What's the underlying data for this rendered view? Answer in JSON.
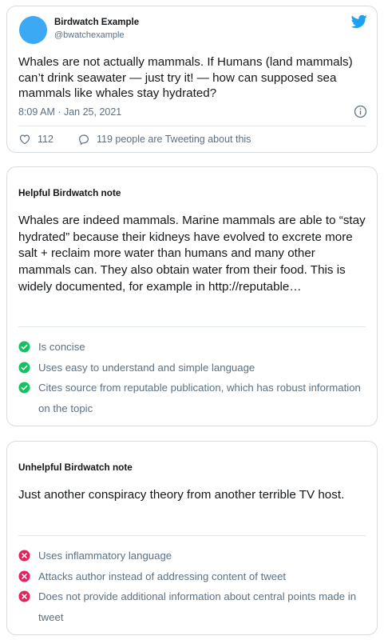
{
  "tweet": {
    "display_name": "Birdwatch Example",
    "handle": "@bwatchexample",
    "text": "Whales are not actually mammals. If Humans (land mammals) can’t drink seawater — just try it! — how can supposed sea mammals like whales stay hydrated?",
    "timestamp": "8:09 AM · Jan 25, 2021",
    "likes": "112",
    "tweeting_about": "119 people are Tweeting about this",
    "avatar_color": "#3ba9f3",
    "brand_color": "#1da1f2",
    "icons": [
      "twitter-bird-icon",
      "info-icon",
      "heart-icon",
      "comment-bubble-icon"
    ]
  },
  "helpful_note": {
    "heading": "Helpful Birdwatch note",
    "text": "Whales are indeed mammals. Marine mammals are able to “stay hydrated” because their kidneys have evolved to excrete more salt + reclaim more water than humans and many other mammals can. They also obtain water from their food. This is widely documented, for example in http://reputable…",
    "reasons": [
      "Is concise",
      "Uses easy to understand and simple language",
      "Cites source from reputable publication, which has robust information on the topic"
    ],
    "reason_icon": "check-circle-icon",
    "reason_color": "#17bf63"
  },
  "unhelpful_note": {
    "heading": "Unhelpful Birdwatch note",
    "text": "Just another conspiracy theory from another terrible TV host.",
    "reasons": [
      "Uses inflammatory language",
      "Attacks author instead of addressing content of tweet",
      "Does not provide additional information about central points made in tweet"
    ],
    "reason_icon": "x-circle-icon",
    "reason_color": "#e0245e"
  }
}
